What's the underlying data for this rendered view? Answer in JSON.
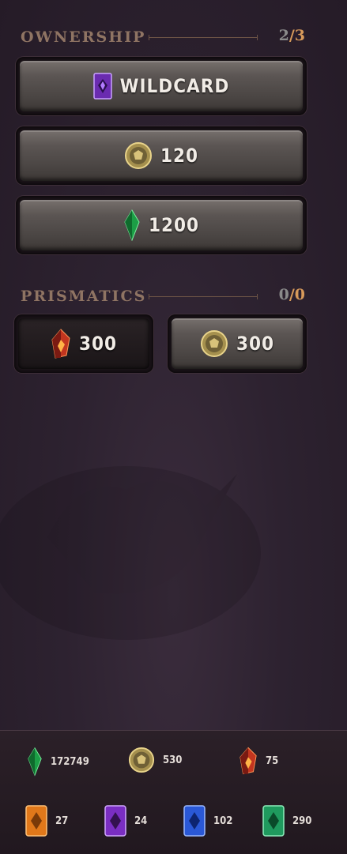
{
  "ownership": {
    "title": "OWNERSHIP",
    "have": "2",
    "sep": "/",
    "total": "3"
  },
  "ownership_buttons": [
    {
      "label": "WILDCARD",
      "icon": "wildcard-card-icon"
    },
    {
      "label": "120",
      "icon": "gold-coin-icon"
    },
    {
      "label": "1200",
      "icon": "green-shard-icon"
    }
  ],
  "prismatics": {
    "title": "PRISMATICS",
    "have": "0",
    "sep": "/",
    "total": "0"
  },
  "prismatic_buttons": [
    {
      "label": "300",
      "icon": "prismatic-shard-icon"
    },
    {
      "label": "300",
      "icon": "gold-coin-icon"
    }
  ],
  "currencies": [
    {
      "label": "172749",
      "icon": "green-shard-icon"
    },
    {
      "label": "530",
      "icon": "gold-coin-icon"
    },
    {
      "label": "75",
      "icon": "red-shard-icon"
    },
    {
      "label": "27",
      "icon": "orange-card-icon"
    },
    {
      "label": "24",
      "icon": "purple-card-icon"
    },
    {
      "label": "102",
      "icon": "blue-card-icon"
    },
    {
      "label": "290",
      "icon": "green-card-icon"
    }
  ],
  "colors": {
    "accent": "#d79a5a",
    "header": "#8f7463",
    "button": "#5b5553"
  }
}
